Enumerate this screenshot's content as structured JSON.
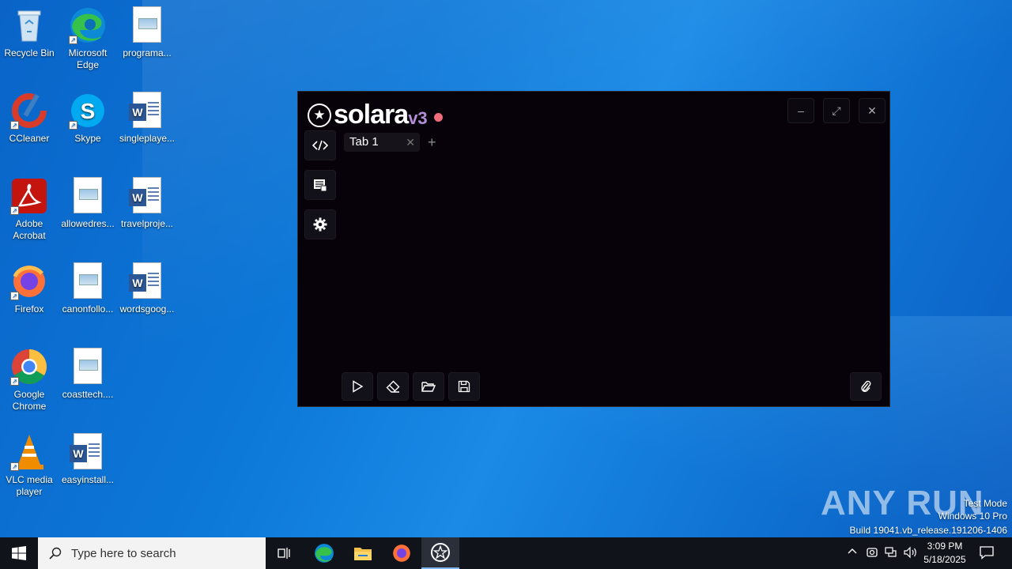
{
  "desktop": {
    "icons": [
      {
        "label": "Recycle Bin",
        "icon": "recycle-bin-icon"
      },
      {
        "label": "Microsoft Edge",
        "icon": "edge-icon"
      },
      {
        "label": "programa...",
        "icon": "image-file-icon"
      },
      {
        "label": "CCleaner",
        "icon": "ccleaner-icon"
      },
      {
        "label": "Skype",
        "icon": "skype-icon"
      },
      {
        "label": "singleplaye...",
        "icon": "word-doc-icon"
      },
      {
        "label": "Adobe Acrobat",
        "icon": "acrobat-icon"
      },
      {
        "label": "allowedres...",
        "icon": "image-file-icon"
      },
      {
        "label": "travelproje...",
        "icon": "word-doc-icon"
      },
      {
        "label": "Firefox",
        "icon": "firefox-icon"
      },
      {
        "label": "canonfollo...",
        "icon": "image-file-icon"
      },
      {
        "label": "wordsgoog...",
        "icon": "word-doc-icon"
      },
      {
        "label": "Google Chrome",
        "icon": "chrome-icon"
      },
      {
        "label": "coasttech....",
        "icon": "image-file-icon"
      },
      {
        "label": "VLC media player",
        "icon": "vlc-icon"
      },
      {
        "label": "easyinstall...",
        "icon": "word-doc-icon"
      }
    ]
  },
  "solara": {
    "name": "solara",
    "version": "v3",
    "tabs": [
      {
        "label": "Tab 1"
      }
    ],
    "add_tab": "+",
    "close_tab": "✕",
    "window_buttons": {
      "minimize": "–",
      "maximize": "⤢",
      "close": "✕"
    },
    "status_color": "#f06b7b"
  },
  "watermark": {
    "logo": "ANY RUN",
    "line1": "Test Mode",
    "line2": "Windows 10 Pro",
    "line3": "Build 19041.vb_release.191206-1406"
  },
  "taskbar": {
    "search_placeholder": "Type here to search",
    "time": "3:09 PM",
    "date": "5/18/2025"
  }
}
